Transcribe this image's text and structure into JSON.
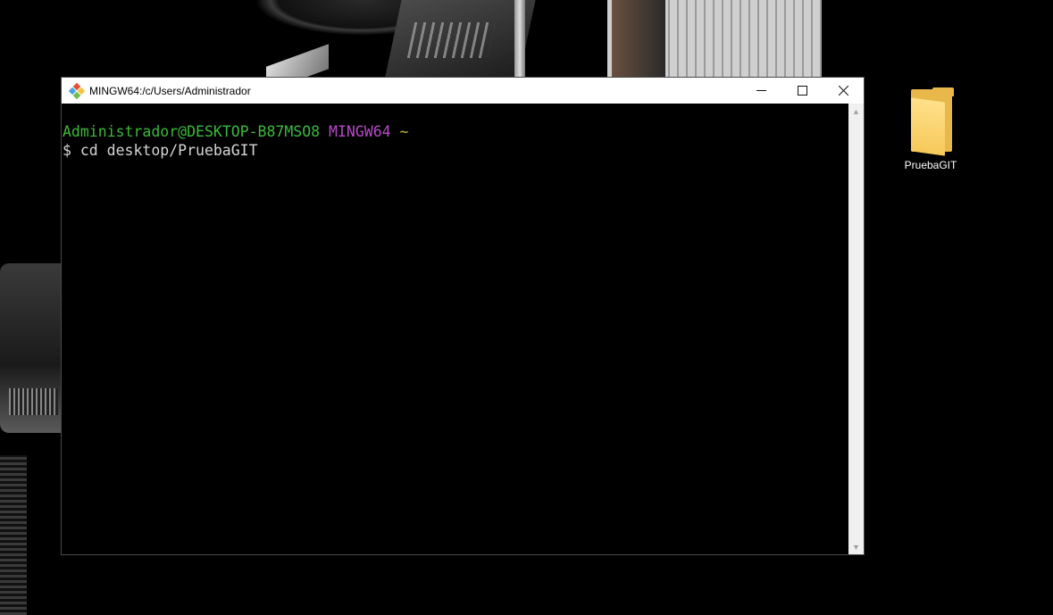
{
  "window": {
    "title": "MINGW64:/c/Users/Administrador",
    "controls": {
      "minimize": "minimize-icon",
      "maximize": "maximize-icon",
      "close": "close-icon"
    }
  },
  "terminal": {
    "prompt_user": "Administrador@DESKTOP-B87MSO8",
    "prompt_env": "MINGW64",
    "prompt_path": "~",
    "command_line": "$ cd desktop/PruebaGIT"
  },
  "desktop": {
    "icons": [
      {
        "label": "PruebaGIT",
        "icon": "folder-icon"
      }
    ]
  },
  "colors": {
    "prompt_user": "#3cb93c",
    "prompt_env": "#b948c8",
    "prompt_path": "#c8b43c",
    "folder": "#f6c95a"
  }
}
